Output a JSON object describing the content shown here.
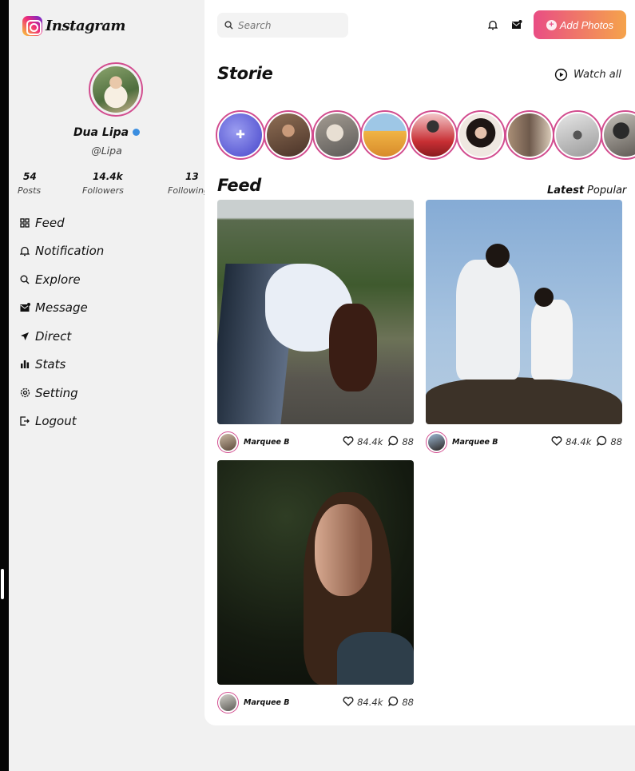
{
  "brand": {
    "name": "Instagram"
  },
  "profile": {
    "name": "Dua Lipa",
    "handle": "@Lipa",
    "stats": [
      {
        "value": "54",
        "label": "Posts"
      },
      {
        "value": "14.4k",
        "label": "Followers"
      },
      {
        "value": "13",
        "label": "Following"
      }
    ]
  },
  "nav": [
    {
      "label": "Feed",
      "icon": "grid-icon"
    },
    {
      "label": "Notification",
      "icon": "bell-icon"
    },
    {
      "label": "Explore",
      "icon": "search-icon"
    },
    {
      "label": "Message",
      "icon": "envelope-icon"
    },
    {
      "label": "Direct",
      "icon": "send-icon"
    },
    {
      "label": "Stats",
      "icon": "bar-chart-icon"
    },
    {
      "label": "Setting",
      "icon": "gear-icon"
    },
    {
      "label": "Logout",
      "icon": "logout-icon"
    }
  ],
  "search": {
    "placeholder": "Search"
  },
  "header": {
    "add_photos": "Add Photos",
    "add_icon": "+"
  },
  "stories": {
    "title": "Storie",
    "watch_all": "Watch all"
  },
  "feed": {
    "title": "Feed",
    "tabs": {
      "latest": "Latest",
      "popular": "Popular"
    },
    "posts": [
      {
        "author": "Marquee B",
        "likes": "84.4k",
        "comments": "88"
      },
      {
        "author": "Marquee B",
        "likes": "84.4k",
        "comments": "88"
      },
      {
        "author": "Marquee B",
        "likes": "84.4k",
        "comments": "88"
      }
    ]
  },
  "colors": {
    "accent": "#d24d8f",
    "button_gradient_start": "#e94d84",
    "button_gradient_end": "#f5a34b",
    "verified": "#3b8ee0"
  }
}
